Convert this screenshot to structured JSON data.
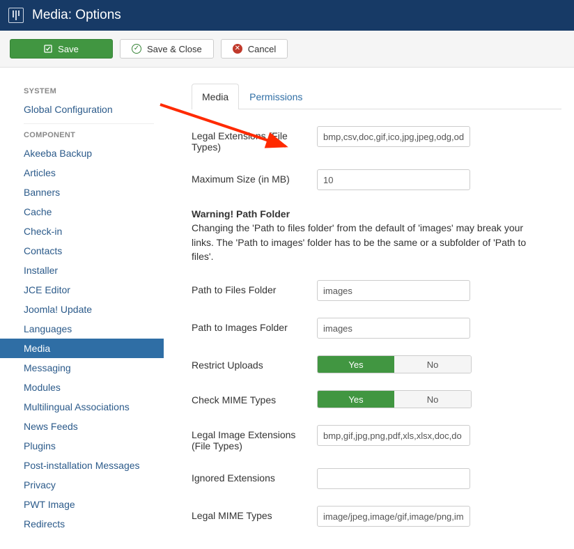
{
  "header": {
    "title": "Media: Options"
  },
  "toolbar": {
    "save": "Save",
    "save_close": "Save & Close",
    "cancel": "Cancel"
  },
  "sidebar": {
    "system_heading": "SYSTEM",
    "system_items": [
      "Global Configuration"
    ],
    "component_heading": "COMPONENT",
    "component_items": [
      "Akeeba Backup",
      "Articles",
      "Banners",
      "Cache",
      "Check-in",
      "Contacts",
      "Installer",
      "JCE Editor",
      "Joomla! Update",
      "Languages",
      "Media",
      "Messaging",
      "Modules",
      "Multilingual Associations",
      "News Feeds",
      "Plugins",
      "Post-installation Messages",
      "Privacy",
      "PWT Image",
      "Redirects"
    ],
    "active": "Media"
  },
  "tabs": {
    "items": [
      "Media",
      "Permissions"
    ],
    "active": "Media"
  },
  "form": {
    "legal_ext_label": "Legal Extensions (File Types)",
    "legal_ext_value": "bmp,csv,doc,gif,ico,jpg,jpeg,odg,od",
    "max_size_label": "Maximum Size (in MB)",
    "max_size_value": "10",
    "warning_title": "Warning! Path Folder",
    "warning_text": "Changing the 'Path to files folder' from the default of 'images' may break your links. The 'Path to images' folder has to be the same or a subfolder of 'Path to files'.",
    "path_files_label": "Path to Files Folder",
    "path_files_value": "images",
    "path_images_label": "Path to Images Folder",
    "path_images_value": "images",
    "restrict_label": "Restrict Uploads",
    "restrict_value": "Yes",
    "mime_label": "Check MIME Types",
    "mime_value": "Yes",
    "legal_img_label": "Legal Image Extensions (File Types)",
    "legal_img_value": "bmp,gif,jpg,png,pdf,xls,xlsx,doc,do",
    "ignored_label": "Ignored Extensions",
    "ignored_value": "",
    "legal_mime_label": "Legal MIME Types",
    "legal_mime_value": "image/jpeg,image/gif,image/png,im",
    "yes": "Yes",
    "no": "No"
  }
}
